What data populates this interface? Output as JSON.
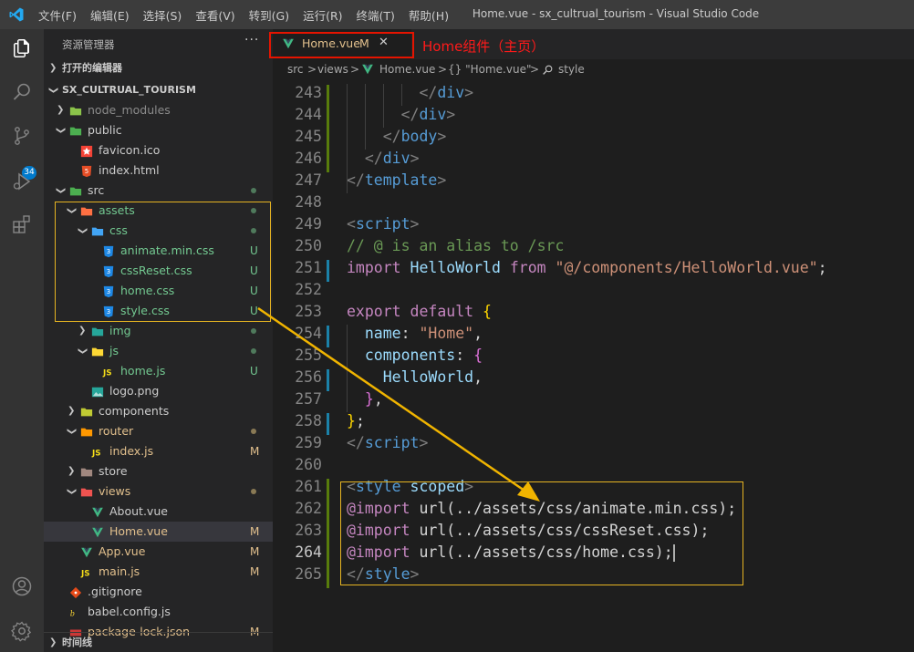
{
  "window": {
    "title": "Home.vue - sx_cultrual_tourism - Visual Studio Code",
    "menu": [
      "文件(F)",
      "编辑(E)",
      "选择(S)",
      "查看(V)",
      "转到(G)",
      "运行(R)",
      "终端(T)",
      "帮助(H)"
    ]
  },
  "activity_bar": {
    "items": [
      "explorer-icon",
      "search-icon",
      "source-control-icon",
      "run-debug-icon",
      "extensions-icon",
      "account-icon",
      "gear-icon"
    ],
    "scm_badge": "34"
  },
  "explorer": {
    "title": "资源管理器",
    "more": "···",
    "open_editors": "打开的编辑器",
    "root": "SX_CULTRUAL_TOURISM",
    "timeline": "时间线",
    "rows": [
      {
        "label": "node_modules",
        "kind": "folder-closed",
        "icon": "node-folder-icon",
        "color": "#8b8b8b",
        "deco": ""
      },
      {
        "label": "public",
        "kind": "folder-open",
        "icon": "public-folder-icon",
        "color": "#cccccc",
        "deco": ""
      },
      {
        "label": "favicon.ico",
        "kind": "file",
        "icon": "favicon-icon",
        "color": "#cccccc",
        "deco": ""
      },
      {
        "label": "index.html",
        "kind": "file",
        "icon": "html-icon",
        "color": "#cccccc",
        "deco": ""
      },
      {
        "label": "src",
        "kind": "folder-open",
        "icon": "src-folder-icon",
        "color": "#cccccc",
        "deco": "dot"
      },
      {
        "label": "assets",
        "kind": "folder-open",
        "icon": "assets-folder-icon",
        "color": "#73c991",
        "deco": "dot"
      },
      {
        "label": "css",
        "kind": "folder-open",
        "icon": "css-folder-icon",
        "color": "#73c991",
        "deco": "dot"
      },
      {
        "label": "animate.min.css",
        "kind": "file",
        "icon": "css-file-icon",
        "color": "#73c991",
        "deco": "U"
      },
      {
        "label": "cssReset.css",
        "kind": "file",
        "icon": "css-file-icon",
        "color": "#73c991",
        "deco": "U"
      },
      {
        "label": "home.css",
        "kind": "file",
        "icon": "css-file-icon",
        "color": "#73c991",
        "deco": "U"
      },
      {
        "label": "style.css",
        "kind": "file",
        "icon": "css-file-icon",
        "color": "#73c991",
        "deco": "U"
      },
      {
        "label": "img",
        "kind": "folder-closed",
        "icon": "img-folder-icon",
        "color": "#73c991",
        "deco": "dot"
      },
      {
        "label": "js",
        "kind": "folder-open",
        "icon": "js-folder-icon",
        "color": "#73c991",
        "deco": "dot"
      },
      {
        "label": "home.js",
        "kind": "file",
        "icon": "js-file-icon",
        "color": "#73c991",
        "deco": "U"
      },
      {
        "label": "logo.png",
        "kind": "file",
        "icon": "image-file-icon",
        "color": "#cccccc",
        "deco": ""
      },
      {
        "label": "components",
        "kind": "folder-closed",
        "icon": "components-folder-icon",
        "color": "#cccccc",
        "deco": ""
      },
      {
        "label": "router",
        "kind": "folder-open",
        "icon": "router-folder-icon",
        "color": "#e2c08d",
        "deco": "dot"
      },
      {
        "label": "index.js",
        "kind": "file",
        "icon": "js-file-icon",
        "color": "#e2c08d",
        "deco": "M"
      },
      {
        "label": "store",
        "kind": "folder-closed",
        "icon": "store-folder-icon",
        "color": "#cccccc",
        "deco": ""
      },
      {
        "label": "views",
        "kind": "folder-open",
        "icon": "views-folder-icon",
        "color": "#e2c08d",
        "deco": "dot"
      },
      {
        "label": "About.vue",
        "kind": "file",
        "icon": "vue-file-icon",
        "color": "#cccccc",
        "deco": ""
      },
      {
        "label": "Home.vue",
        "kind": "file",
        "icon": "vue-file-icon",
        "color": "#e2c08d",
        "deco": "M"
      },
      {
        "label": "App.vue",
        "kind": "file",
        "icon": "vue-file-icon",
        "color": "#e2c08d",
        "deco": "M"
      },
      {
        "label": "main.js",
        "kind": "file",
        "icon": "js-file-icon",
        "color": "#e2c08d",
        "deco": "M"
      },
      {
        "label": ".gitignore",
        "kind": "file",
        "icon": "git-file-icon",
        "color": "#cccccc",
        "deco": ""
      },
      {
        "label": "babel.config.js",
        "kind": "file",
        "icon": "babel-file-icon",
        "color": "#cccccc",
        "deco": ""
      },
      {
        "label": "package-lock.json",
        "kind": "file",
        "icon": "npm-file-icon",
        "color": "#e2c08d",
        "deco": "M"
      }
    ]
  },
  "editor": {
    "tab": {
      "label": "Home.vue",
      "modified": "M",
      "close": "✕"
    },
    "breadcrumb": [
      "src",
      ">",
      "views",
      ">",
      "Home.vue",
      ">",
      "{} \"Home.vue\"",
      ">",
      "style"
    ],
    "lines": [
      {
        "n": "243",
        "tokens": [
          [
            "        ",
            "#d4d4d4"
          ],
          [
            "</",
            "#808080"
          ],
          [
            "div",
            "#569cd6"
          ],
          [
            ">",
            "#808080"
          ]
        ]
      },
      {
        "n": "244",
        "tokens": [
          [
            "      ",
            "#d4d4d4"
          ],
          [
            "</",
            "#808080"
          ],
          [
            "div",
            "#569cd6"
          ],
          [
            ">",
            "#808080"
          ]
        ]
      },
      {
        "n": "245",
        "tokens": [
          [
            "    ",
            "#d4d4d4"
          ],
          [
            "</",
            "#808080"
          ],
          [
            "body",
            "#569cd6"
          ],
          [
            ">",
            "#808080"
          ]
        ]
      },
      {
        "n": "246",
        "tokens": [
          [
            "  ",
            "#d4d4d4"
          ],
          [
            "</",
            "#808080"
          ],
          [
            "div",
            "#569cd6"
          ],
          [
            ">",
            "#808080"
          ]
        ]
      },
      {
        "n": "247",
        "tokens": [
          [
            "</",
            "#808080"
          ],
          [
            "template",
            "#569cd6"
          ],
          [
            ">",
            "#808080"
          ]
        ]
      },
      {
        "n": "248",
        "tokens": []
      },
      {
        "n": "249",
        "tokens": [
          [
            "<",
            "#808080"
          ],
          [
            "script",
            "#569cd6"
          ],
          [
            ">",
            "#808080"
          ]
        ]
      },
      {
        "n": "250",
        "tokens": [
          [
            "// @ is an alias to /src",
            "#6a9955"
          ]
        ]
      },
      {
        "n": "251",
        "tokens": [
          [
            "import",
            "#c586c0"
          ],
          [
            " HelloWorld ",
            "#9cdcfe"
          ],
          [
            "from",
            "#c586c0"
          ],
          [
            " \"@/components/HelloWorld.vue\"",
            "#ce9178"
          ],
          [
            ";",
            "#d4d4d4"
          ]
        ]
      },
      {
        "n": "252",
        "tokens": []
      },
      {
        "n": "253",
        "tokens": [
          [
            "export",
            "#c586c0"
          ],
          [
            " ",
            "#d4d4d4"
          ],
          [
            "default",
            "#c586c0"
          ],
          [
            " ",
            "#d4d4d4"
          ],
          [
            "{",
            "#ffd700"
          ]
        ]
      },
      {
        "n": "254",
        "tokens": [
          [
            "  name",
            "#9cdcfe"
          ],
          [
            ": ",
            "#d4d4d4"
          ],
          [
            "\"Home\"",
            "#ce9178"
          ],
          [
            ",",
            "#d4d4d4"
          ]
        ]
      },
      {
        "n": "255",
        "tokens": [
          [
            "  components",
            "#9cdcfe"
          ],
          [
            ": ",
            "#d4d4d4"
          ],
          [
            "{",
            "#da70d6"
          ]
        ]
      },
      {
        "n": "256",
        "tokens": [
          [
            "    HelloWorld",
            "#9cdcfe"
          ],
          [
            ",",
            "#d4d4d4"
          ]
        ]
      },
      {
        "n": "257",
        "tokens": [
          [
            "  ",
            "#d4d4d4"
          ],
          [
            "}",
            "#da70d6"
          ],
          [
            ",",
            "#d4d4d4"
          ]
        ]
      },
      {
        "n": "258",
        "tokens": [
          [
            "}",
            "#ffd700"
          ],
          [
            ";",
            "#d4d4d4"
          ]
        ]
      },
      {
        "n": "259",
        "tokens": [
          [
            "</",
            "#808080"
          ],
          [
            "script",
            "#569cd6"
          ],
          [
            ">",
            "#808080"
          ]
        ]
      },
      {
        "n": "260",
        "tokens": []
      },
      {
        "n": "261",
        "tokens": [
          [
            "<",
            "#808080"
          ],
          [
            "style",
            "#569cd6"
          ],
          [
            " ",
            "#d4d4d4"
          ],
          [
            "scoped",
            "#9cdcfe"
          ],
          [
            ">",
            "#808080"
          ]
        ]
      },
      {
        "n": "262",
        "tokens": [
          [
            "@import",
            "#c586c0"
          ],
          [
            " url(../assets/css/animate.min.css)",
            "#d4d4d4"
          ],
          [
            ";",
            "#d4d4d4"
          ]
        ]
      },
      {
        "n": "263",
        "tokens": [
          [
            "@import",
            "#c586c0"
          ],
          [
            " url(../assets/css/cssReset.css)",
            "#d4d4d4"
          ],
          [
            ";",
            "#d4d4d4"
          ]
        ]
      },
      {
        "n": "264",
        "tokens": [
          [
            "@import",
            "#c586c0"
          ],
          [
            " url(../assets/css/home.css)",
            "#d4d4d4"
          ],
          [
            ";",
            "#d4d4d4"
          ]
        ]
      },
      {
        "n": "265",
        "tokens": [
          [
            "</",
            "#808080"
          ],
          [
            "style",
            "#569cd6"
          ],
          [
            ">",
            "#808080"
          ]
        ]
      }
    ]
  },
  "annotation": {
    "text": "Home组件（主页）"
  },
  "colors": {
    "accent": "#007acc",
    "untracked": "#73c991",
    "modified": "#e2c08d",
    "annotation_red": "#e51400",
    "annotation_yellow": "#e6b422"
  }
}
